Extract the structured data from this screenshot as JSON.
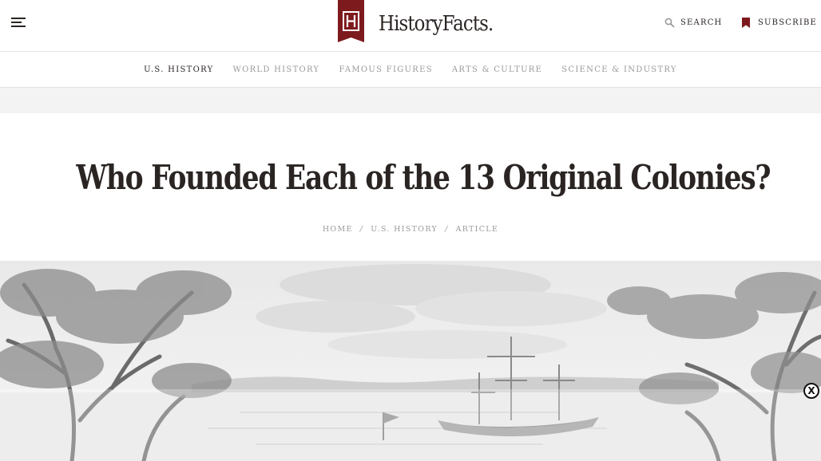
{
  "header": {
    "logo_text": "HistoryFacts.",
    "search_label": "SEARCH",
    "subscribe_label": "SUBSCRIBE",
    "accent_color": "#7d1a1d"
  },
  "nav": {
    "items": [
      {
        "label": "U.S. HISTORY",
        "active": true
      },
      {
        "label": "WORLD HISTORY",
        "active": false
      },
      {
        "label": "FAMOUS FIGURES",
        "active": false
      },
      {
        "label": "ARTS & CULTURE",
        "active": false
      },
      {
        "label": "SCIENCE & INDUSTRY",
        "active": false
      }
    ]
  },
  "article": {
    "title": "Who Founded Each of the 13 Original Colonies?",
    "breadcrumb": {
      "home": "HOME",
      "section": "U.S. HISTORY",
      "current": "ARTICLE",
      "separator": "/"
    }
  },
  "ad": {
    "close_label": "X"
  }
}
